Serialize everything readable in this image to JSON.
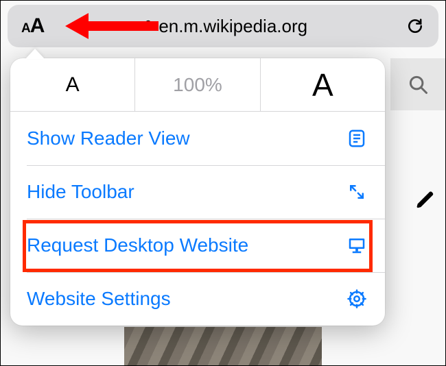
{
  "addressbar": {
    "aa_small": "A",
    "aa_large": "A",
    "url": "en.m.wikipedia.org"
  },
  "zoom": {
    "dec": "A",
    "level": "100%",
    "inc": "A"
  },
  "menu": {
    "reader": "Show Reader View",
    "hide": "Hide Toolbar",
    "desktop": "Request Desktop Website",
    "settings": "Website Settings"
  }
}
